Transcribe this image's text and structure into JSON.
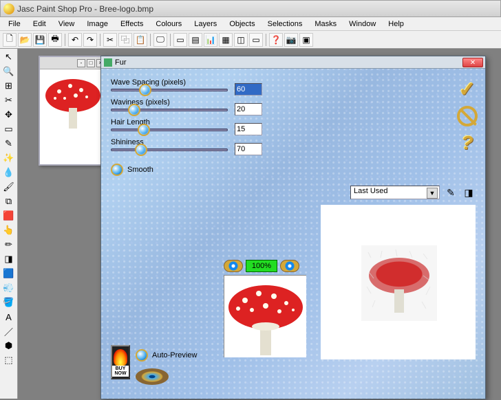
{
  "app": {
    "title": "Jasc Paint Shop Pro - Bree-logo.bmp"
  },
  "menu": [
    "File",
    "Edit",
    "View",
    "Image",
    "Effects",
    "Colours",
    "Layers",
    "Objects",
    "Selections",
    "Masks",
    "Window",
    "Help"
  ],
  "dialog": {
    "title": "Fur",
    "sliders": {
      "waveSpacing": {
        "label": "Wave Spacing (pixels)",
        "value": "60",
        "pos": 40
      },
      "waviness": {
        "label": "Waviness (pixels)",
        "value": "20",
        "pos": 24
      },
      "hairLength": {
        "label": "Hair Length",
        "value": "15",
        "pos": 38
      },
      "shininess": {
        "label": "Shininess",
        "value": "70",
        "pos": 34
      }
    },
    "smooth": "Smooth",
    "autoPreview": "Auto-Preview",
    "preset": "Last Used",
    "zoom": "100%",
    "buyNow": "BUY\nNOW"
  },
  "icons": {
    "check": "ok",
    "cancel": "cancel",
    "help": "help",
    "pencil": "✎",
    "eraser": "◨"
  }
}
